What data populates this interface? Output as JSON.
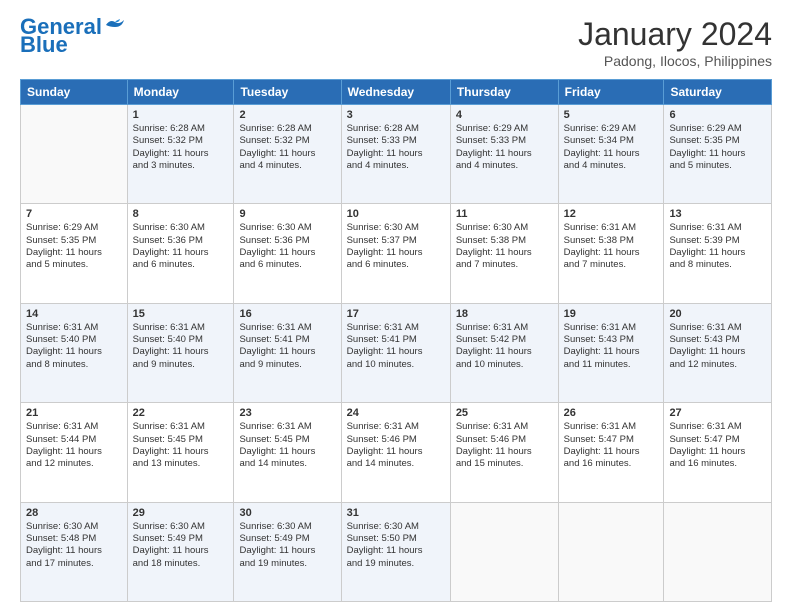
{
  "header": {
    "logo": {
      "line1": "General",
      "line2": "Blue"
    },
    "title": "January 2024",
    "subtitle": "Padong, Ilocos, Philippines"
  },
  "columns": [
    "Sunday",
    "Monday",
    "Tuesday",
    "Wednesday",
    "Thursday",
    "Friday",
    "Saturday"
  ],
  "weeks": [
    [
      {
        "day": "",
        "content": ""
      },
      {
        "day": "1",
        "content": "Sunrise: 6:28 AM\nSunset: 5:32 PM\nDaylight: 11 hours\nand 3 minutes."
      },
      {
        "day": "2",
        "content": "Sunrise: 6:28 AM\nSunset: 5:32 PM\nDaylight: 11 hours\nand 4 minutes."
      },
      {
        "day": "3",
        "content": "Sunrise: 6:28 AM\nSunset: 5:33 PM\nDaylight: 11 hours\nand 4 minutes."
      },
      {
        "day": "4",
        "content": "Sunrise: 6:29 AM\nSunset: 5:33 PM\nDaylight: 11 hours\nand 4 minutes."
      },
      {
        "day": "5",
        "content": "Sunrise: 6:29 AM\nSunset: 5:34 PM\nDaylight: 11 hours\nand 4 minutes."
      },
      {
        "day": "6",
        "content": "Sunrise: 6:29 AM\nSunset: 5:35 PM\nDaylight: 11 hours\nand 5 minutes."
      }
    ],
    [
      {
        "day": "7",
        "content": "Sunrise: 6:29 AM\nSunset: 5:35 PM\nDaylight: 11 hours\nand 5 minutes."
      },
      {
        "day": "8",
        "content": "Sunrise: 6:30 AM\nSunset: 5:36 PM\nDaylight: 11 hours\nand 6 minutes."
      },
      {
        "day": "9",
        "content": "Sunrise: 6:30 AM\nSunset: 5:36 PM\nDaylight: 11 hours\nand 6 minutes."
      },
      {
        "day": "10",
        "content": "Sunrise: 6:30 AM\nSunset: 5:37 PM\nDaylight: 11 hours\nand 6 minutes."
      },
      {
        "day": "11",
        "content": "Sunrise: 6:30 AM\nSunset: 5:38 PM\nDaylight: 11 hours\nand 7 minutes."
      },
      {
        "day": "12",
        "content": "Sunrise: 6:31 AM\nSunset: 5:38 PM\nDaylight: 11 hours\nand 7 minutes."
      },
      {
        "day": "13",
        "content": "Sunrise: 6:31 AM\nSunset: 5:39 PM\nDaylight: 11 hours\nand 8 minutes."
      }
    ],
    [
      {
        "day": "14",
        "content": "Sunrise: 6:31 AM\nSunset: 5:40 PM\nDaylight: 11 hours\nand 8 minutes."
      },
      {
        "day": "15",
        "content": "Sunrise: 6:31 AM\nSunset: 5:40 PM\nDaylight: 11 hours\nand 9 minutes."
      },
      {
        "day": "16",
        "content": "Sunrise: 6:31 AM\nSunset: 5:41 PM\nDaylight: 11 hours\nand 9 minutes."
      },
      {
        "day": "17",
        "content": "Sunrise: 6:31 AM\nSunset: 5:41 PM\nDaylight: 11 hours\nand 10 minutes."
      },
      {
        "day": "18",
        "content": "Sunrise: 6:31 AM\nSunset: 5:42 PM\nDaylight: 11 hours\nand 10 minutes."
      },
      {
        "day": "19",
        "content": "Sunrise: 6:31 AM\nSunset: 5:43 PM\nDaylight: 11 hours\nand 11 minutes."
      },
      {
        "day": "20",
        "content": "Sunrise: 6:31 AM\nSunset: 5:43 PM\nDaylight: 11 hours\nand 12 minutes."
      }
    ],
    [
      {
        "day": "21",
        "content": "Sunrise: 6:31 AM\nSunset: 5:44 PM\nDaylight: 11 hours\nand 12 minutes."
      },
      {
        "day": "22",
        "content": "Sunrise: 6:31 AM\nSunset: 5:45 PM\nDaylight: 11 hours\nand 13 minutes."
      },
      {
        "day": "23",
        "content": "Sunrise: 6:31 AM\nSunset: 5:45 PM\nDaylight: 11 hours\nand 14 minutes."
      },
      {
        "day": "24",
        "content": "Sunrise: 6:31 AM\nSunset: 5:46 PM\nDaylight: 11 hours\nand 14 minutes."
      },
      {
        "day": "25",
        "content": "Sunrise: 6:31 AM\nSunset: 5:46 PM\nDaylight: 11 hours\nand 15 minutes."
      },
      {
        "day": "26",
        "content": "Sunrise: 6:31 AM\nSunset: 5:47 PM\nDaylight: 11 hours\nand 16 minutes."
      },
      {
        "day": "27",
        "content": "Sunrise: 6:31 AM\nSunset: 5:47 PM\nDaylight: 11 hours\nand 16 minutes."
      }
    ],
    [
      {
        "day": "28",
        "content": "Sunrise: 6:30 AM\nSunset: 5:48 PM\nDaylight: 11 hours\nand 17 minutes."
      },
      {
        "day": "29",
        "content": "Sunrise: 6:30 AM\nSunset: 5:49 PM\nDaylight: 11 hours\nand 18 minutes."
      },
      {
        "day": "30",
        "content": "Sunrise: 6:30 AM\nSunset: 5:49 PM\nDaylight: 11 hours\nand 19 minutes."
      },
      {
        "day": "31",
        "content": "Sunrise: 6:30 AM\nSunset: 5:50 PM\nDaylight: 11 hours\nand 19 minutes."
      },
      {
        "day": "",
        "content": ""
      },
      {
        "day": "",
        "content": ""
      },
      {
        "day": "",
        "content": ""
      }
    ]
  ]
}
